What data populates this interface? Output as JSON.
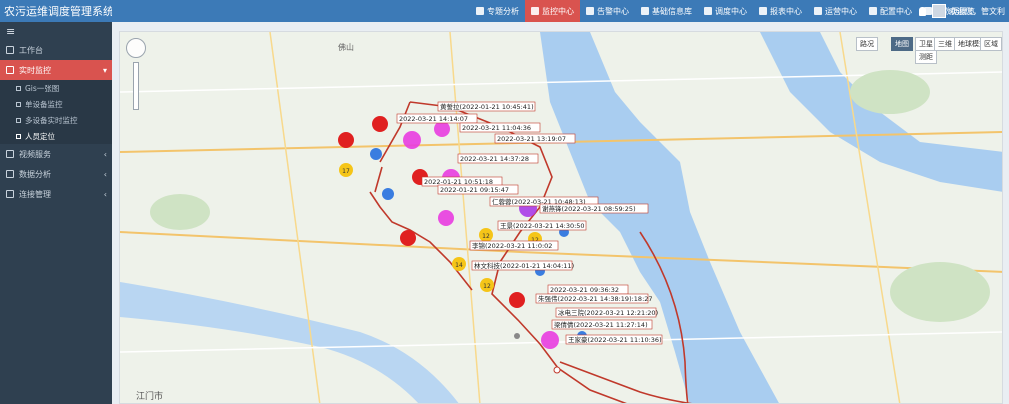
{
  "app": {
    "title": "农污运维调度管理系统"
  },
  "topnav": [
    {
      "label": "专题分析",
      "active": false
    },
    {
      "label": "监控中心",
      "active": true
    },
    {
      "label": "告警中心",
      "active": false
    },
    {
      "label": "基础信息库",
      "active": false
    },
    {
      "label": "调度中心",
      "active": false
    },
    {
      "label": "报表中心",
      "active": false
    },
    {
      "label": "运营中心",
      "active": false
    },
    {
      "label": "配置中心",
      "active": false
    },
    {
      "label": "大数据概览",
      "active": false
    }
  ],
  "user": {
    "greeting": "欢迎您，管文利"
  },
  "sidebar": {
    "collapse_icon": "≡",
    "items": [
      {
        "label": "工作台"
      },
      {
        "label": "实时监控",
        "active": true
      },
      {
        "label": "视频服务"
      },
      {
        "label": "数据分析"
      },
      {
        "label": "连接管理"
      }
    ],
    "sub_items": [
      {
        "label": "Gis一张图"
      },
      {
        "label": "单设备监控"
      },
      {
        "label": "多设备实时监控"
      },
      {
        "label": "人员定位",
        "active": true
      }
    ]
  },
  "map_controls": {
    "traffic": "路况",
    "map": "地图",
    "satellite": "卫星",
    "three_d": "三维",
    "earth": "地球模式",
    "ranging": "测距",
    "more": "区域"
  },
  "map_places": [
    {
      "label": "江门市"
    },
    {
      "label": "佛山"
    }
  ],
  "markers": [
    {
      "label": "黄誓拉(2022-01-21 10:45:41)"
    },
    {
      "label": "2022-03-21 14:14:07"
    },
    {
      "label": "2022-03-21 11:04:36"
    },
    {
      "label": "2022-03-21 13:19:07"
    },
    {
      "label": "2022-03-21 14:37:28"
    },
    {
      "label": "2022-01-21 10:51:18"
    },
    {
      "label": "2022-01-21 09:15:47"
    },
    {
      "label": "仁蓉蓉(2022-03-21 10:48:13)"
    },
    {
      "label": "谢燕锋(2022-03-21 08:59:25)"
    },
    {
      "label": "王景(2022-03-21 14:30:50"
    },
    {
      "label": "李锦(2022-03-21 11:0:02"
    },
    {
      "label": "林文科技(2022-01-21 14:04:11)"
    },
    {
      "label": "2022-03-21 09:36:32"
    },
    {
      "label": "朱强伟(2022-03-21 14:38:19):18:27"
    },
    {
      "label": "冰电三院(2022-03-21 12:21:20)"
    },
    {
      "label": "梁倩倩(2022-03-21 11:27:14)"
    },
    {
      "label": "王家豪(2022-03-21 11:10:36)"
    }
  ],
  "clusters": [
    {
      "count": "17"
    },
    {
      "count": "12"
    },
    {
      "count": "12"
    },
    {
      "count": "14"
    },
    {
      "count": "12"
    }
  ],
  "colors": {
    "topbar": "#3c7ab7",
    "active": "#d9534f",
    "sidebar": "#2f4050",
    "route": "#c0392b"
  }
}
